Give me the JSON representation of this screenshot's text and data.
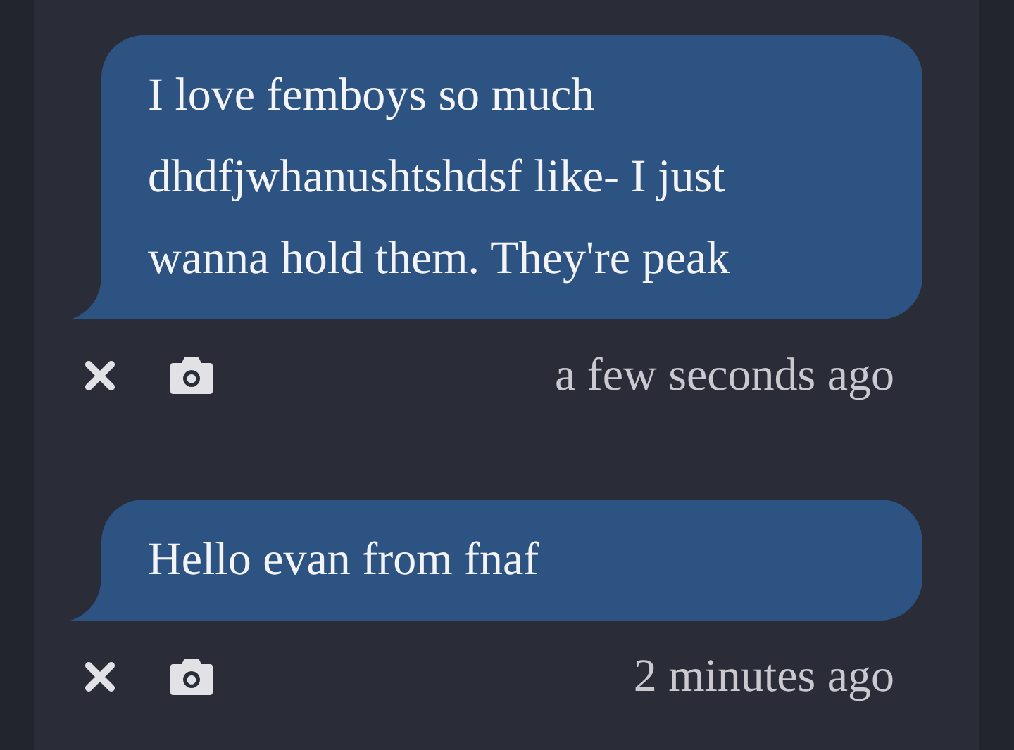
{
  "messages": [
    {
      "text": "I love femboys so much dhdfjwhanushtshdsf like- I just wanna hold them. They're peak",
      "time": "a few seconds ago"
    },
    {
      "text": "Hello evan from fnaf",
      "time": "2 minutes ago"
    }
  ]
}
